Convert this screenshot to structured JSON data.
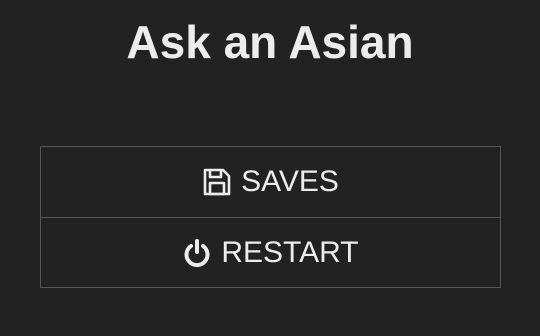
{
  "page": {
    "title": "Ask an Asian"
  },
  "menu": {
    "items": [
      {
        "label": "SAVES",
        "icon": "save-icon"
      },
      {
        "label": "RESTART",
        "icon": "power-icon"
      }
    ]
  },
  "colors": {
    "background": "#222222",
    "text": "#ececec",
    "border": "#555555"
  }
}
